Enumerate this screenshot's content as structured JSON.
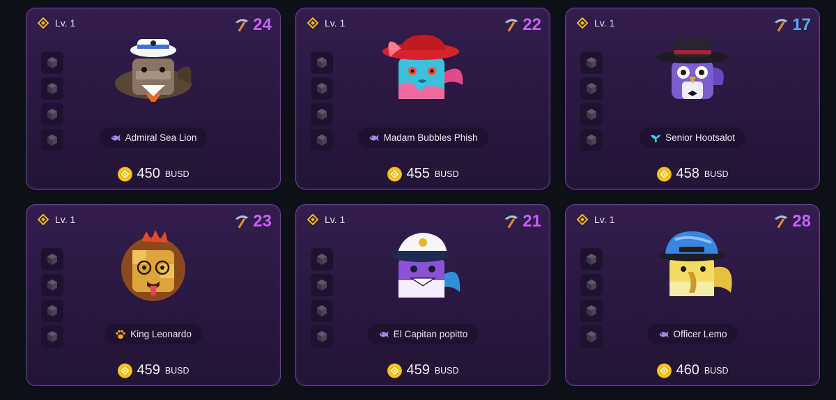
{
  "cards": [
    {
      "level": "Lv. 1",
      "power": "24",
      "power_color": "#c463f0",
      "name": "Admiral Sea Lion",
      "class": "fish",
      "class_color": "#9d8cf0",
      "price": "450",
      "currency": "BUSD",
      "avatar": "sea-lion"
    },
    {
      "level": "Lv. 1",
      "power": "22",
      "power_color": "#c463f0",
      "name": "Madam Bubbles Phish",
      "class": "fish",
      "class_color": "#9d8cf0",
      "price": "455",
      "currency": "BUSD",
      "avatar": "phish"
    },
    {
      "level": "Lv. 1",
      "power": "17",
      "power_color": "#5aa9f2",
      "name": "Senior Hootsalot",
      "class": "bird",
      "class_color": "#3fc4f0",
      "price": "458",
      "currency": "BUSD",
      "avatar": "owl"
    },
    {
      "level": "Lv. 1",
      "power": "23",
      "power_color": "#c463f0",
      "name": "King Leonardo",
      "class": "paw",
      "class_color": "#f0a030",
      "price": "459",
      "currency": "BUSD",
      "avatar": "lion"
    },
    {
      "level": "Lv. 1",
      "power": "21",
      "power_color": "#c463f0",
      "name": "El Capitan popitto",
      "class": "fish",
      "class_color": "#9d8cf0",
      "price": "459",
      "currency": "BUSD",
      "avatar": "captain"
    },
    {
      "level": "Lv. 1",
      "power": "28",
      "power_color": "#c463f0",
      "name": "Officer Lemo",
      "class": "fish",
      "class_color": "#9d8cf0",
      "price": "460",
      "currency": "BUSD",
      "avatar": "lemo"
    }
  ]
}
